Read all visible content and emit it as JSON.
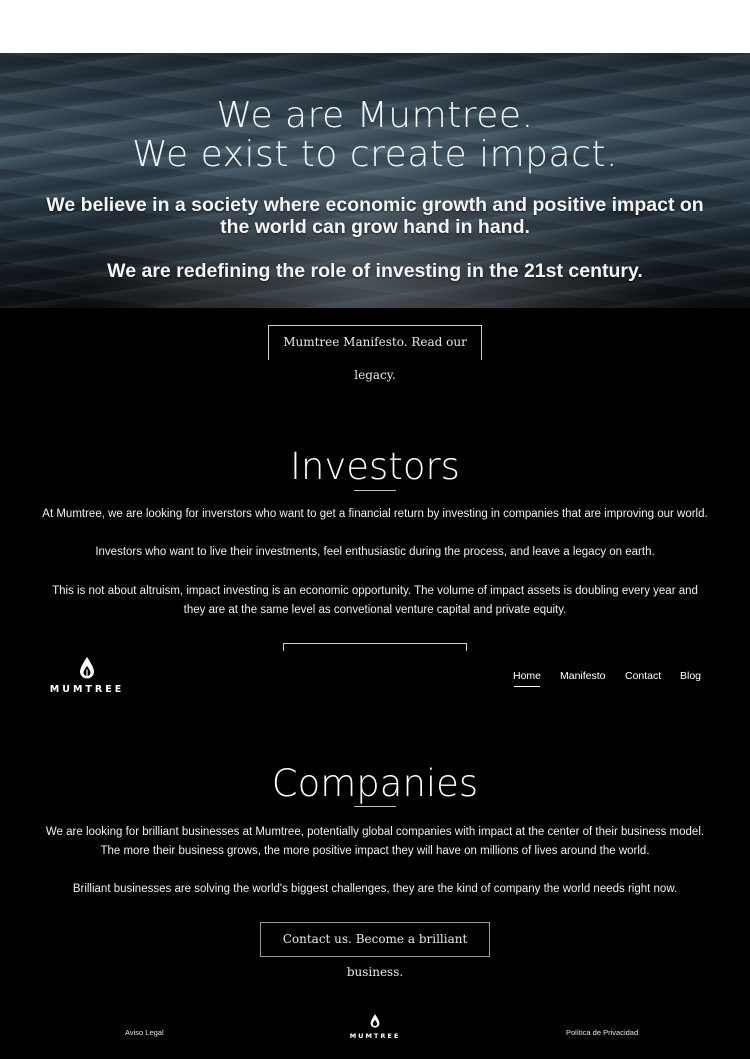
{
  "hero": {
    "title_line1": "We are Mumtree.",
    "title_line2": "We exist to create impact.",
    "subtitle": "We believe in a society where economic growth and positive impact on the world can grow hand in hand.",
    "tagline": "We are redefining the role of investing in the 21st century.",
    "button_label": "Mumtree Manifesto. Read our legacy."
  },
  "investors": {
    "title": "Investors",
    "paragraph1_line1": "At Mumtree, we are looking for inverstors who want to get a financial return by investing in companies that are improving our world.",
    "paragraph1_line2": "Investors who want to live their investments, feel enthusiastic during the process, and leave a legacy on earth.",
    "paragraph2": "This is not about altruism, impact investing is an economic opportunity. The volume of impact assets is doubling every year and they are at the same level as convetional venture capital and private equity."
  },
  "nav": {
    "logo_text": "MUMTREE",
    "items": [
      {
        "label": "Home"
      },
      {
        "label": "Manifesto"
      },
      {
        "label": "Contact"
      },
      {
        "label": "Blog"
      }
    ],
    "active": "Home"
  },
  "companies": {
    "title": "Companies",
    "paragraph1": "We are looking for brilliant businesses at Mumtree, potentially global companies with impact at the center of their business model. The more their business grows, the more positive impact they will have on millions of lives around the world.",
    "paragraph2": "Brilliant businesses are solving the world's biggest challenges, they are the kind of company the world needs right now.",
    "button_label": "Contact us. Become a brilliant business."
  },
  "footer": {
    "left_link": "Aviso Legal",
    "logo_text": "MUMTREE",
    "right_link": "Política de Privacidad"
  },
  "colors": {
    "background": "#000000",
    "text": "#ffffff",
    "button_border": "#cfcfcf"
  }
}
